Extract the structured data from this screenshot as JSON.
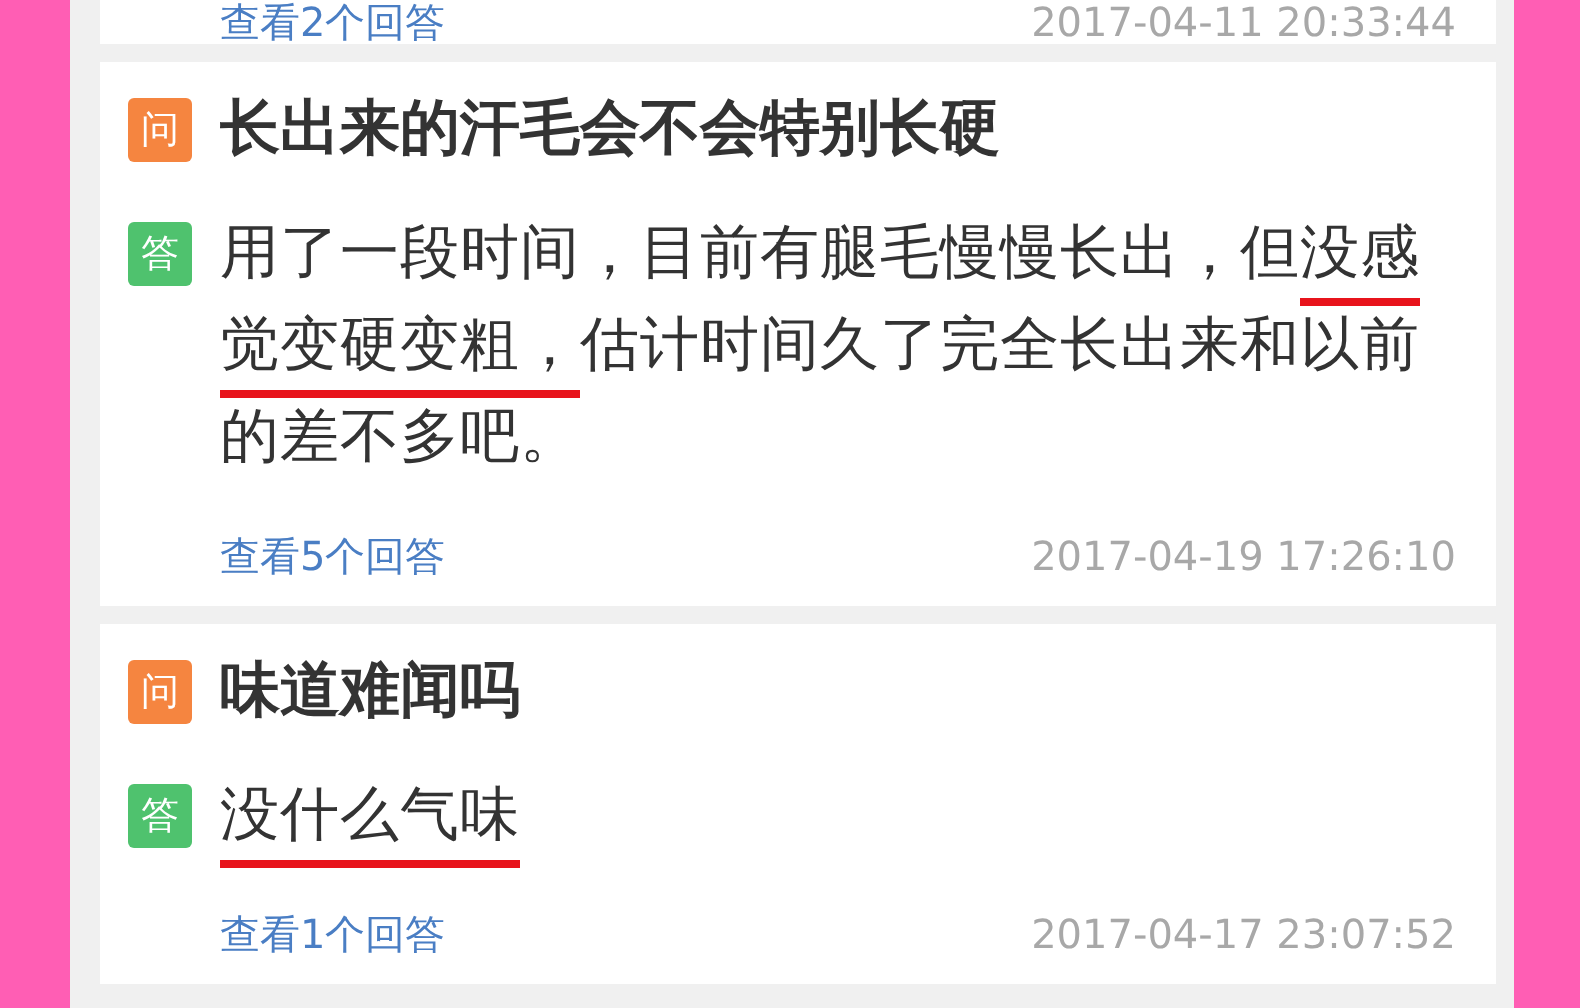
{
  "items": [
    {
      "partial": true,
      "more": "查看2个回答",
      "time": "2017-04-11 20:33:44"
    },
    {
      "partial": false,
      "q_badge": "问",
      "question": "长出来的汗毛会不会特别长硬",
      "a_badge": "答",
      "answer": [
        {
          "text": "用了一段时间，目前有腿毛慢慢长出，但",
          "underlined": false
        },
        {
          "text": "没感觉变硬变粗，",
          "underlined": true
        },
        {
          "text": "估计时间久了完全长出来和以前的差不多吧。",
          "underlined": false
        }
      ],
      "more": "查看5个回答",
      "time": "2017-04-19 17:26:10"
    },
    {
      "partial": false,
      "q_badge": "问",
      "question": "味道难闻吗",
      "a_badge": "答",
      "answer": [
        {
          "text": "没什么气味",
          "underlined": true
        }
      ],
      "more": "查看1个回答",
      "time": "2017-04-17 23:07:52"
    }
  ]
}
